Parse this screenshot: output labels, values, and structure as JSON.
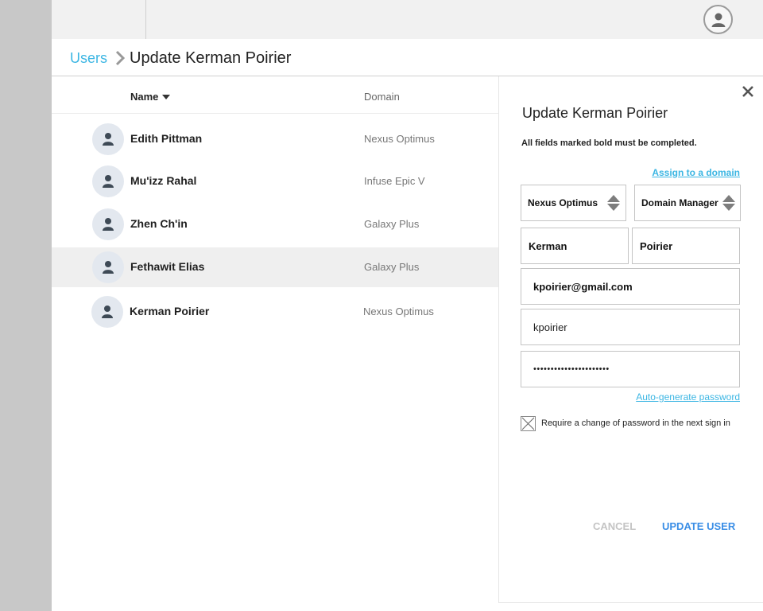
{
  "topbar": {
    "account_icon": "user-avatar-icon"
  },
  "breadcrumb": {
    "parent": "Users",
    "current": "Update Kerman Poirier"
  },
  "table": {
    "headers": {
      "name": "Name",
      "domain": "Domain"
    },
    "sort": "descending",
    "rows": [
      {
        "name": "Edith Pittman",
        "domain": "Nexus Optimus"
      },
      {
        "name": "Mu'izz Rahal",
        "domain": "Infuse Epic V"
      },
      {
        "name": "Zhen Ch'in",
        "domain": "Galaxy Plus"
      },
      {
        "name": "Fethawit Elias",
        "domain": "Galaxy Plus",
        "selected": true
      },
      {
        "name": "Kerman Poirier",
        "domain": "Nexus Optimus"
      }
    ]
  },
  "panel": {
    "title": "Update Kerman Poirier",
    "note": "All fields marked bold must be completed.",
    "assign_link": "Assign to a domain",
    "domain_select": "Nexus Optimus",
    "role_select": "Domain Manager",
    "first_name": "Kerman",
    "last_name": "Poirier",
    "email": "kpoirier@gmail.com",
    "username": "kpoirier",
    "password": "••••••••••••••••••••••",
    "autogen_link": "Auto-generate password",
    "require_change_label": "Require a change of password in the next sign in",
    "require_change_checked": true,
    "cancel_label": "CANCEL",
    "update_label": "UPDATE USER"
  },
  "colors": {
    "accent": "#3cb6e3",
    "primary_button": "#3a8ee6",
    "rail": "#c8c8c8",
    "selected_row": "#efefef"
  }
}
